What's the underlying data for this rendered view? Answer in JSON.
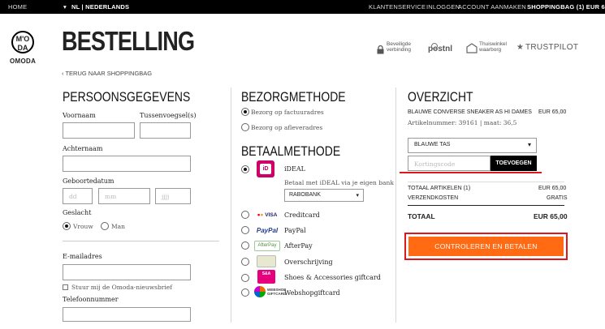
{
  "topbar": {
    "home": "HOME",
    "locale": "NL | NEDERLANDS",
    "customer_service": "KLANTENSERVICE",
    "login": "INLOGGEN",
    "create_account": "ACCOUNT AANMAKEN",
    "bag": "SHOPPINGBAG (1) EUR 65,00"
  },
  "header": {
    "logo_mark": "M'O DA",
    "logo_text": "OMODA",
    "title": "BESTELLING",
    "trust_secure_line1": "Beveiligde",
    "trust_secure_line2": "verbinding",
    "trust_postnl": "postnl",
    "trust_guarantee_line1": "Thuiswinkel",
    "trust_guarantee_line2": "waarborg",
    "trust_pilot": "TRUSTPILOT",
    "back_link": "‹  TERUG NAAR SHOPPINGBAG"
  },
  "personal": {
    "heading": "PERSOONSGEGEVENS",
    "first_name_label": "Voornaam",
    "infix_label": "Tussenvoegsel(s)",
    "last_name_label": "Achternaam",
    "birthdate_label": "Geboortedatum",
    "dd_placeholder": "dd",
    "mm_placeholder": "mm",
    "yyyy_placeholder": "jjjj",
    "gender_label": "Geslacht",
    "gender_female": "Vrouw",
    "gender_male": "Man",
    "email_label": "E-mailadres",
    "newsletter_label": "Stuur mij de Omoda-nieuwsbrief",
    "phone_label": "Telefoonnummer"
  },
  "delivery": {
    "heading": "BEZORGMETHODE",
    "option_billing": "Bezorg op factuuradres",
    "option_other": "Bezorg op afleveradres"
  },
  "payment": {
    "heading": "BETAALMETHODE",
    "ideal_label": "iDEAL",
    "ideal_info": "Betaal met iDEAL via je eigen bank",
    "bank_selected": "RABOBANK",
    "methods": [
      {
        "label": "Creditcard",
        "icon": "creditcard-icon"
      },
      {
        "label": "PayPal",
        "icon": "paypal-icon"
      },
      {
        "label": "AfterPay",
        "icon": "afterpay-icon"
      },
      {
        "label": "Overschrijving",
        "icon": "bank-transfer-icon"
      },
      {
        "label": "Shoes & Accessories giftcard",
        "icon": "giftcard-icon"
      },
      {
        "label": "Webshopgiftcard",
        "icon": "webshop-giftcard-icon"
      }
    ]
  },
  "overview": {
    "heading": "OVERZICHT",
    "product_name": "BLAUWE CONVERSE SNEAKER AS HI DAMES",
    "product_price": "EUR 65,00",
    "product_meta": "Artikelnummer: 39161 | maat: 36,5",
    "coupon_select": "BLAUWE TAS",
    "coupon_placeholder": "Kortingscode",
    "coupon_button": "TOEVOEGEN",
    "total_items_label": "TOTAAL ARTIKELEN (1)",
    "total_items_value": "EUR 65,00",
    "shipping_label": "VERZENDKOSTEN",
    "shipping_value": "GRATIS",
    "total_label": "TOTAAL",
    "total_value": "EUR 65,00",
    "checkout_button": "CONTROLEREN EN BETALEN"
  },
  "colors": {
    "accent_orange": "#ff6a13",
    "highlight_red": "#e0161b",
    "topbar": "#000000"
  }
}
